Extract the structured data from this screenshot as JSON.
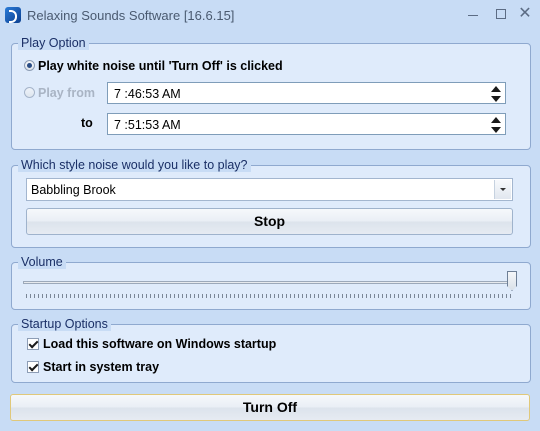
{
  "window": {
    "title": "Relaxing Sounds Software [16.6.15]"
  },
  "play_option": {
    "legend": "Play Option",
    "white_noise_label": "Play white noise until 'Turn Off' is clicked",
    "play_from_label": "Play from",
    "to_label": "to",
    "from_time": "7 :46:53 AM",
    "to_time": "7 :51:53 AM",
    "selected": "white_noise"
  },
  "style": {
    "legend": "Which style noise would you like to play?",
    "selected": "Babbling Brook",
    "stop_label": "Stop"
  },
  "volume": {
    "legend": "Volume",
    "level": 1.0
  },
  "startup": {
    "legend": "Startup Options",
    "options": [
      {
        "label": "Load this software on Windows startup",
        "checked": true
      },
      {
        "label": "Start in system tray",
        "checked": true
      }
    ]
  },
  "turn_off_label": "Turn Off",
  "icons": [
    "app-icon",
    "minimize-icon",
    "maximize-icon",
    "close-icon",
    "spin-up-icon",
    "spin-down-icon",
    "dropdown-arrow-icon"
  ]
}
